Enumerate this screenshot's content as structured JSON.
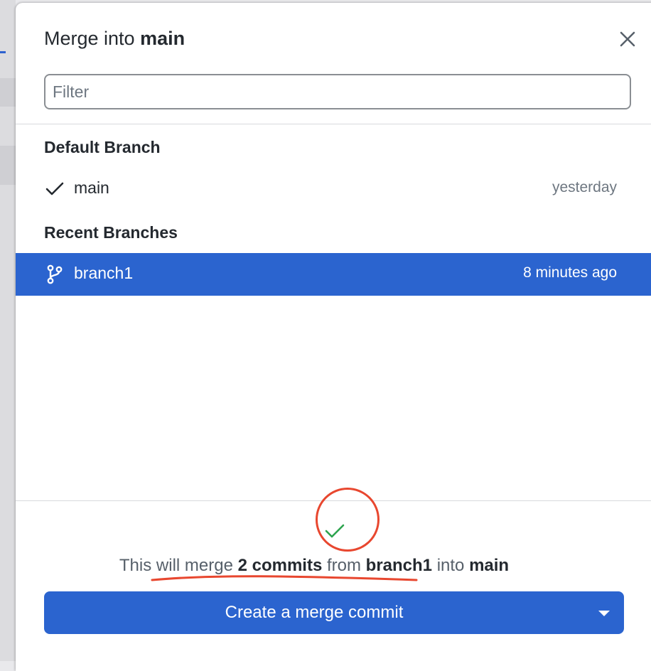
{
  "dialog": {
    "title_prefix": "Merge into",
    "title_branch": "main",
    "close_icon": "close-icon"
  },
  "filter": {
    "placeholder": "Filter",
    "value": ""
  },
  "default_section": {
    "header": "Default Branch",
    "branch": {
      "name": "main",
      "time": "yesterday",
      "icon": "checkmark-icon"
    }
  },
  "recent_section": {
    "header": "Recent Branches",
    "branch": {
      "name": "branch1",
      "time": "8 minutes ago",
      "icon": "git-branch-icon",
      "selected": true
    }
  },
  "merge_status": {
    "icon": "success-check-icon",
    "text_1": "This will merge",
    "commits": "2 commits",
    "text_2": "from",
    "source": "branch1",
    "text_3": "into",
    "target": "main"
  },
  "merge_button": {
    "label": "Create a merge commit",
    "dropdown_icon": "caret-down-icon"
  },
  "colors": {
    "accent": "#2b64cf",
    "success": "#2da44e",
    "annotation": "#e8472f"
  }
}
